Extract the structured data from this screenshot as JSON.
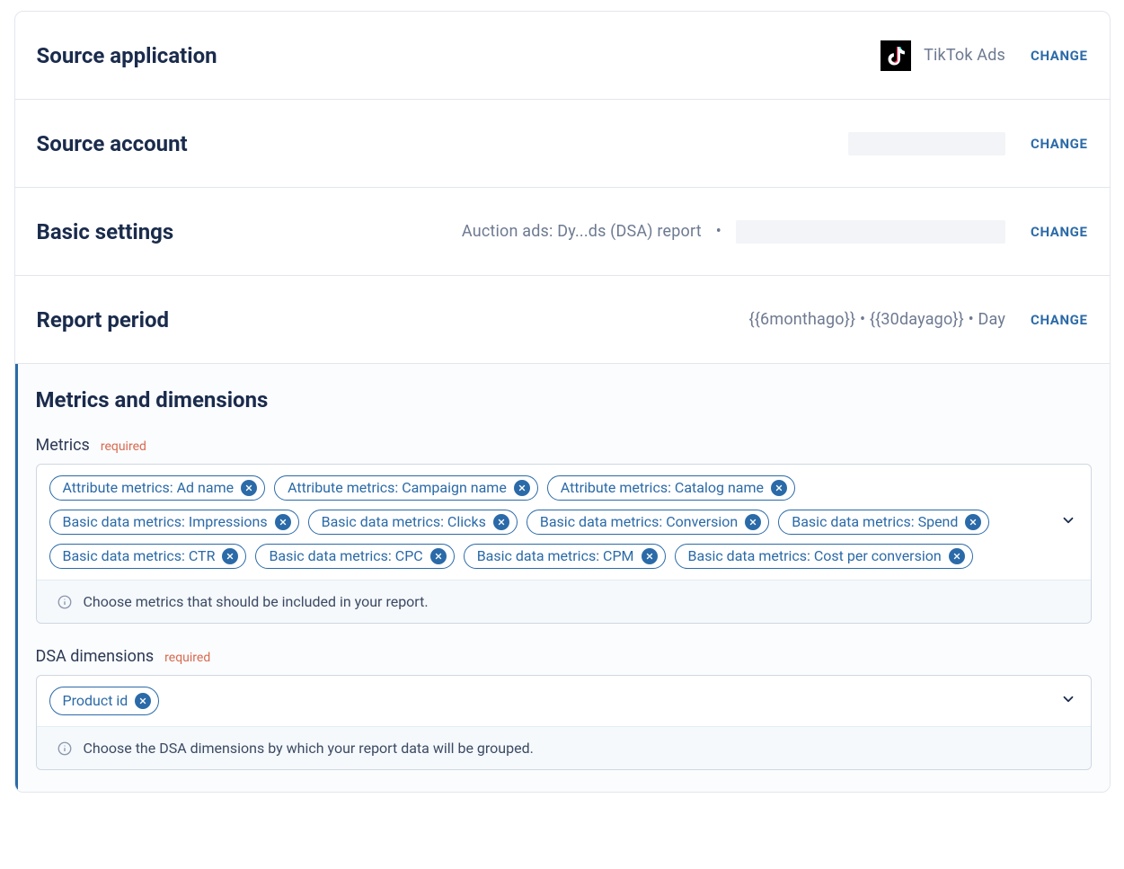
{
  "sections": {
    "source_application": {
      "title": "Source application",
      "value": "TikTok Ads",
      "change_label": "CHANGE"
    },
    "source_account": {
      "title": "Source account",
      "change_label": "CHANGE"
    },
    "basic_settings": {
      "title": "Basic settings",
      "value_prefix": "Auction ads: Dy...ds (DSA) report",
      "change_label": "CHANGE"
    },
    "report_period": {
      "title": "Report period",
      "value": "{{6monthago}} • {{30dayago}} • Day",
      "change_label": "CHANGE"
    }
  },
  "metrics_block": {
    "title": "Metrics and dimensions",
    "metrics_label": "Metrics",
    "required_label": "required",
    "metrics_hint": "Choose metrics that should be included in your report.",
    "metrics_chips": [
      "Attribute metrics: Ad name",
      "Attribute metrics: Campaign name",
      "Attribute metrics: Catalog name",
      "Basic data metrics: Impressions",
      "Basic data metrics: Clicks",
      "Basic data metrics: Conversion",
      "Basic data metrics: Spend",
      "Basic data metrics: CTR",
      "Basic data metrics: CPC",
      "Basic data metrics: CPM",
      "Basic data metrics: Cost per conversion"
    ],
    "dsa_label": "DSA dimensions",
    "dsa_hint": "Choose the DSA dimensions by which your report data will be grouped.",
    "dsa_chips": [
      "Product id"
    ]
  },
  "colors": {
    "accent": "#2b6aa8",
    "text": "#1a2b4c",
    "muted": "#6e7a91",
    "required": "#d86a4f"
  }
}
